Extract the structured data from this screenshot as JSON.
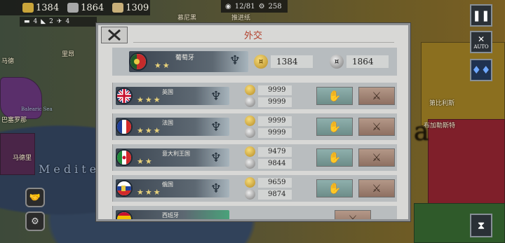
{
  "top": {
    "gold": "1384",
    "industry": "1864",
    "manpower": "1309",
    "sub": [
      "4",
      "2",
      "4"
    ],
    "turn": "12/81",
    "other": "258"
  },
  "map_labels": {
    "bavaria": "慕尼黑",
    "lisbon": "推进纸",
    "north": "里昂",
    "barcelona": "巴塞罗那",
    "madrid": "马德里",
    "left_west": "马德",
    "belgrade": "第比利斯",
    "bucharest": "布加勒斯特",
    "sea": "Medite",
    "east_sea": "Balearic Sea",
    "big_letter": "a"
  },
  "dialog": {
    "title": "外交",
    "own": {
      "name": "葡萄牙",
      "stars": "★★",
      "gold": "1384",
      "industry": "1864"
    },
    "nations": [
      {
        "name": "英国",
        "stars": "★★★",
        "gold": "9999",
        "industry": "9999",
        "flag": "uk",
        "ally_icon": "handshake-icon",
        "war_icon": "crossed-swords-icon"
      },
      {
        "name": "法国",
        "stars": "★★★",
        "gold": "9999",
        "industry": "9999",
        "flag": "fr",
        "ally_icon": "handshake-icon",
        "war_icon": "crossed-swords-icon"
      },
      {
        "name": "意大利王国",
        "stars": "★★",
        "gold": "9479",
        "industry": "9844",
        "flag": "it",
        "ally_icon": "handshake-icon",
        "war_icon": "crossed-swords-icon"
      },
      {
        "name": "俄国",
        "stars": "★★★",
        "gold": "9659",
        "industry": "9874",
        "flag": "ru",
        "ally_icon": "handshake-icon",
        "war_icon": "crossed-swords-icon"
      },
      {
        "name": "西班牙",
        "stars": "",
        "gold": "",
        "industry": "",
        "flag": "es",
        "ally_icon": "",
        "war_icon": "crossed-swords-icon"
      }
    ]
  },
  "right_controls": {
    "pause": "❚❚",
    "auto": "AUTO"
  },
  "colors": {
    "title_red": "#b23f2b",
    "ally_green": "#7ea19d",
    "war_brown": "#a28474"
  }
}
